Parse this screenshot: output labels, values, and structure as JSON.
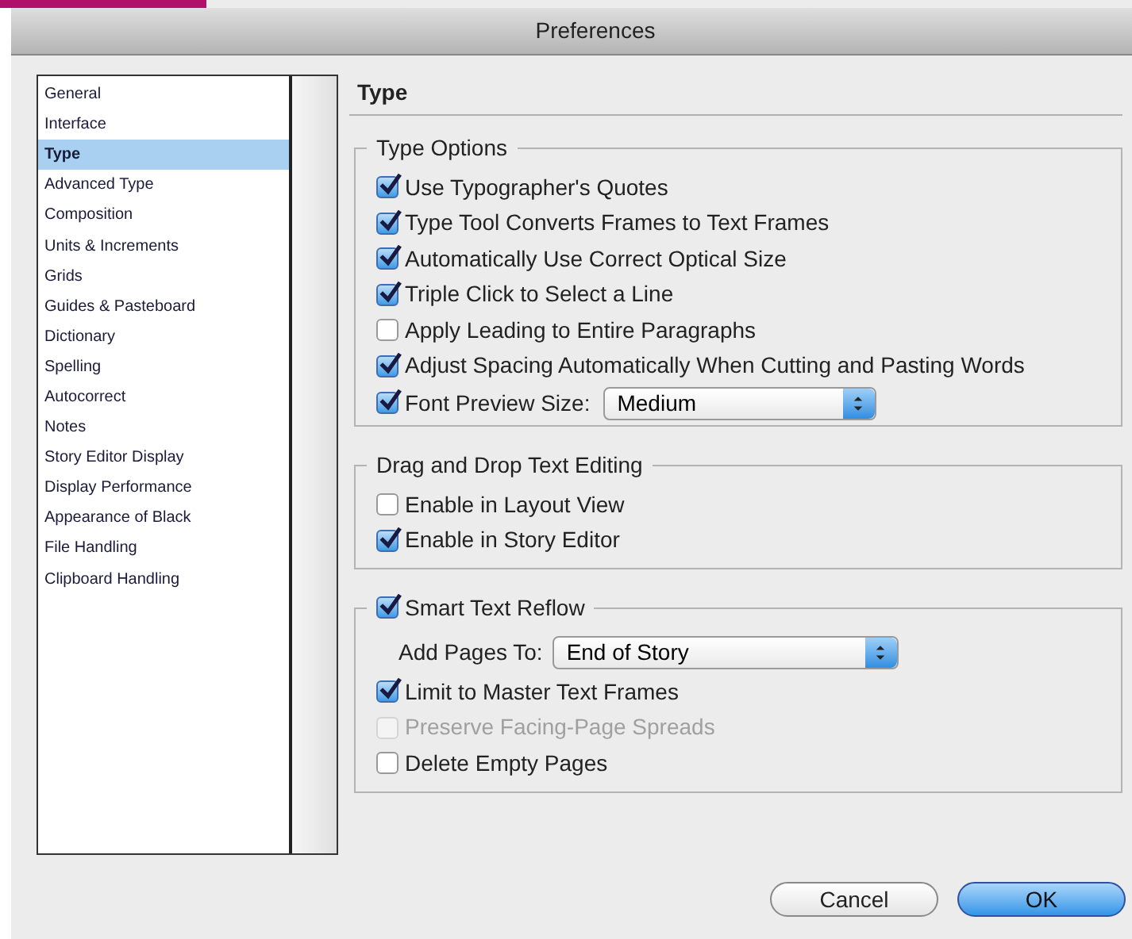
{
  "window": {
    "title": "Preferences"
  },
  "sidebar": {
    "items": [
      {
        "label": "General",
        "selected": false
      },
      {
        "label": "Interface",
        "selected": false
      },
      {
        "label": "Type",
        "selected": true
      },
      {
        "label": "Advanced Type",
        "selected": false
      },
      {
        "label": "Composition",
        "selected": false
      },
      {
        "label": "Units & Increments",
        "selected": false
      },
      {
        "label": "Grids",
        "selected": false
      },
      {
        "label": "Guides & Pasteboard",
        "selected": false
      },
      {
        "label": "Dictionary",
        "selected": false
      },
      {
        "label": "Spelling",
        "selected": false
      },
      {
        "label": "Autocorrect",
        "selected": false
      },
      {
        "label": "Notes",
        "selected": false
      },
      {
        "label": "Story Editor Display",
        "selected": false
      },
      {
        "label": "Display Performance",
        "selected": false
      },
      {
        "label": "Appearance of Black",
        "selected": false
      },
      {
        "label": "File Handling",
        "selected": false
      },
      {
        "label": "Clipboard Handling",
        "selected": false
      }
    ]
  },
  "panel": {
    "title": "Type",
    "groups": [
      {
        "title": "Type Options",
        "rows": [
          {
            "kind": "checkbox",
            "label": "Use Typographer's Quotes",
            "checked": true,
            "disabled": false
          },
          {
            "kind": "checkbox",
            "label": "Type Tool Converts Frames to Text Frames",
            "checked": true,
            "disabled": false
          },
          {
            "kind": "checkbox",
            "label": "Automatically Use Correct Optical Size",
            "checked": true,
            "disabled": false
          },
          {
            "kind": "checkbox",
            "label": "Triple Click to Select a Line",
            "checked": true,
            "disabled": false
          },
          {
            "kind": "checkbox",
            "label": "Apply Leading to Entire Paragraphs",
            "checked": false,
            "disabled": false
          },
          {
            "kind": "checkbox",
            "label": "Adjust Spacing Automatically When Cutting and Pasting Words",
            "checked": true,
            "disabled": false
          },
          {
            "kind": "checkbox-select",
            "label": "Font Preview Size:",
            "checked": true,
            "disabled": false,
            "value": "Medium"
          }
        ]
      },
      {
        "title": "Drag and Drop Text Editing",
        "rows": [
          {
            "kind": "checkbox",
            "label": "Enable in Layout View",
            "checked": false,
            "disabled": false
          },
          {
            "kind": "checkbox",
            "label": "Enable in Story Editor",
            "checked": true,
            "disabled": false
          }
        ]
      },
      {
        "title": "Smart Text Reflow",
        "checked": true,
        "rows": [
          {
            "kind": "select",
            "label": "Add Pages To:",
            "value": "End of Story"
          },
          {
            "kind": "checkbox",
            "label": "Limit to Master Text Frames",
            "checked": true,
            "disabled": false
          },
          {
            "kind": "checkbox",
            "label": "Preserve Facing-Page Spreads",
            "checked": false,
            "disabled": true
          },
          {
            "kind": "checkbox",
            "label": "Delete Empty Pages",
            "checked": false,
            "disabled": false
          }
        ]
      }
    ]
  },
  "buttons": [
    {
      "label": "Cancel",
      "kind": "secondary"
    },
    {
      "label": "OK",
      "kind": "primary"
    }
  ]
}
